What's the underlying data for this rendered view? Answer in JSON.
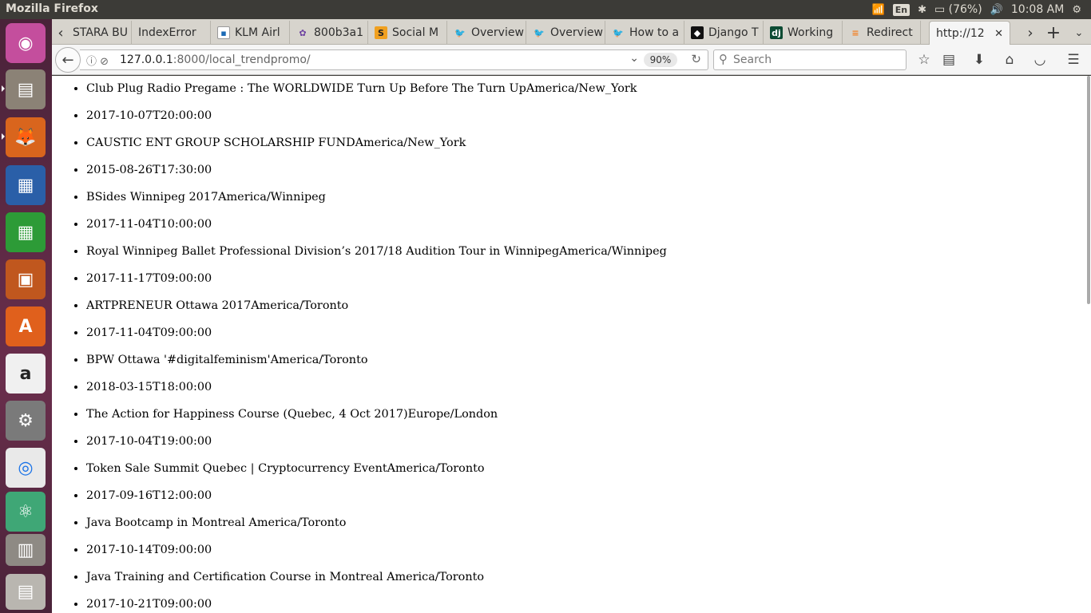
{
  "os": {
    "window_title": "Mozilla Firefox",
    "language_indicator": "En",
    "battery_text": "(76%)",
    "clock": "10:08 AM"
  },
  "launcher": {
    "apps": [
      "ubuntu-dash",
      "files",
      "firefox",
      "libreoffice-writer",
      "libreoffice-calc",
      "libreoffice-impress",
      "ubuntu-software",
      "amazon",
      "system-settings",
      "chrome",
      "atom",
      "workspace-switcher",
      "trash"
    ]
  },
  "browser": {
    "tabs": [
      {
        "label": "STARA BU",
        "icon": "page-icon"
      },
      {
        "label": "IndexError",
        "icon": "page-icon"
      },
      {
        "label": "KLM Airl",
        "icon": "klm-icon"
      },
      {
        "label": "800b3a1",
        "icon": "stripe-icon"
      },
      {
        "label": "Social M",
        "icon": "stackoverflow-icon"
      },
      {
        "label": "Overview",
        "icon": "twitter-icon"
      },
      {
        "label": "Overview",
        "icon": "twitter-icon"
      },
      {
        "label": "How to a",
        "icon": "twitter-icon"
      },
      {
        "label": "Django T",
        "icon": "page-icon"
      },
      {
        "label": "Working",
        "icon": "django-icon"
      },
      {
        "label": "Redirect",
        "icon": "stackoverflow-icon"
      },
      {
        "label": "http://12",
        "icon": "none",
        "active": true
      }
    ],
    "url_host": "127.0.0.1",
    "url_rest": ":8000/local_trendpromo/",
    "zoom": "90%",
    "search_placeholder": "Search"
  },
  "page": {
    "items": [
      "Club Plug Radio Pregame : The WORLDWIDE Turn Up Before The Turn UpAmerica/New_York",
      "2017-10-07T20:00:00",
      "CAUSTIC ENT GROUP SCHOLARSHIP FUNDAmerica/New_York",
      "2015-08-26T17:30:00",
      "BSides Winnipeg 2017America/Winnipeg",
      "2017-11-04T10:00:00",
      "Royal Winnipeg Ballet Professional Division’s 2017/18 Audition Tour in WinnipegAmerica/Winnipeg",
      "2017-11-17T09:00:00",
      "ARTPRENEUR Ottawa 2017America/Toronto",
      "2017-11-04T09:00:00",
      "BPW Ottawa '#digitalfeminism'America/Toronto",
      "2018-03-15T18:00:00",
      "The Action for Happiness Course (Quebec, 4 Oct 2017)Europe/London",
      "2017-10-04T19:00:00",
      "Token Sale Summit Quebec | Cryptocurrency EventAmerica/Toronto",
      "2017-09-16T12:00:00",
      "Java Bootcamp in Montreal America/Toronto",
      "2017-10-14T09:00:00",
      "Java Training and Certification Course in Montreal America/Toronto",
      "2017-10-21T09:00:00"
    ]
  }
}
